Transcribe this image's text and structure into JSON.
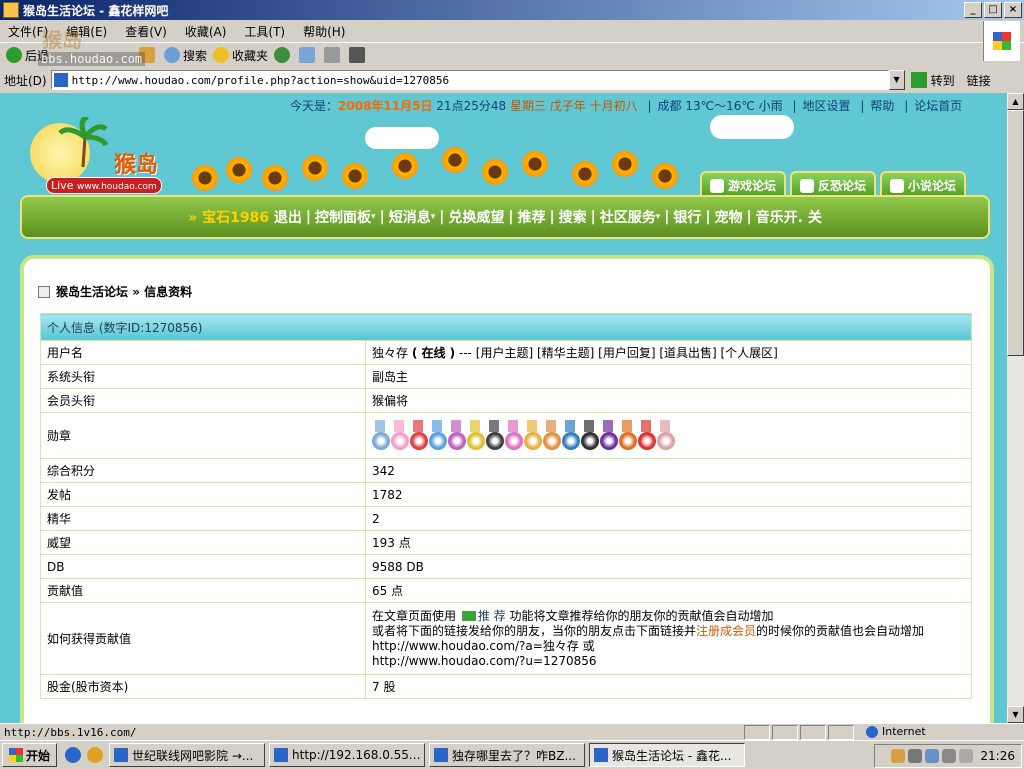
{
  "window": {
    "title": "猴岛生活论坛 - 鑫花样网吧"
  },
  "menu": [
    "文件(F)",
    "编辑(E)",
    "查看(V)",
    "收藏(A)",
    "工具(T)",
    "帮助(H)"
  ],
  "toolbar": {
    "back": "后退",
    "search": "搜索",
    "favorites": "收藏夹"
  },
  "watermark": {
    "brand": "猴岛",
    "url": "bbs.houdao.com"
  },
  "address": {
    "label": "地址(D)",
    "url": "http://www.houdao.com/profile.php?action=show&uid=1270856",
    "go": "转到",
    "links": "链接"
  },
  "topinfo": {
    "today_label": "今天是：",
    "date": "2008年11月5日",
    "time": "21点25分48",
    "weekday": "星期三",
    "lunar_year": "戊子年",
    "lunar_day": "十月初八",
    "weather": "成都 13℃～16℃ 小雨",
    "region": "地区设置",
    "help": "帮助",
    "home": "论坛首页"
  },
  "logo": {
    "name": "猴岛",
    "live": "Live",
    "url": "www.houdao.com"
  },
  "forum_tabs": [
    "游戏论坛",
    "反恐论坛",
    "小说论坛"
  ],
  "nav": {
    "gem": "» 宝石1986",
    "items": [
      "退出",
      "控制面板",
      "短消息",
      "兑换威望",
      "推荐",
      "搜索",
      "社区服务",
      "银行",
      "宠物",
      "音乐开. 关"
    ]
  },
  "breadcrumb": {
    "forum": "猴岛生活论坛",
    "page": "» 信息资料"
  },
  "profile": {
    "header": "个人信息 (数字ID:1270856)",
    "username": {
      "label": "用户名",
      "name": "独々存",
      "status": "( 在线 )",
      "links": " --- [用户主题] [精华主题] [用户回复] [道具出售] [个人展区]"
    },
    "rows": [
      {
        "label": "系统头衔",
        "value": "副岛主"
      },
      {
        "label": "会员头衔",
        "value": "猴偏将"
      }
    ],
    "medals_label": "勋章",
    "medal_colors": [
      "#7aa9d8",
      "#f3a0c8",
      "#e04040",
      "#5aa0e0",
      "#c060c0",
      "#e0c030",
      "#404040",
      "#e070c0",
      "#e8b040",
      "#e09040",
      "#3080c0",
      "#303030",
      "#7030a0",
      "#e07020",
      "#e03030",
      "#e0a0a0"
    ],
    "stats": [
      {
        "label": "综合积分",
        "value": "342"
      },
      {
        "label": "发帖",
        "value": "1782"
      },
      {
        "label": "精华",
        "value": "2"
      },
      {
        "label": "威望",
        "value": "193 点"
      },
      {
        "label": "DB",
        "value": "9588 DB"
      },
      {
        "label": "贡献值",
        "value": "65 点"
      }
    ],
    "howto": {
      "label": "如何获得贡献值",
      "line1_pre": "在文章页面使用 ",
      "line1_btn": "推 荐",
      "line1_post": " 功能将文章推荐给你的朋友你的贡献值会自动增加",
      "line2_pre": "或者将下面的链接发给你的朋友，当你的朋友点击下面链接并",
      "line2_link": "注册成会员",
      "line2_post": "的时候你的贡献值也会自动增加",
      "line3": "http://www.houdao.com/?a=独々存 或",
      "line4": "http://www.houdao.com/?u=1270856"
    },
    "stock": {
      "label": "股金(股市资本)",
      "value": "7 股"
    }
  },
  "statusbar": {
    "url": "http://bbs.1v16.com/",
    "zone": "Internet"
  },
  "taskbar": {
    "start": "开始",
    "tasks": [
      "世纪联线网吧影院 →...",
      "http://192.168.0.55...",
      "独存哪里去了？咋BZ...",
      "猴岛生活论坛 - 鑫花..."
    ],
    "clock": "21:26"
  }
}
